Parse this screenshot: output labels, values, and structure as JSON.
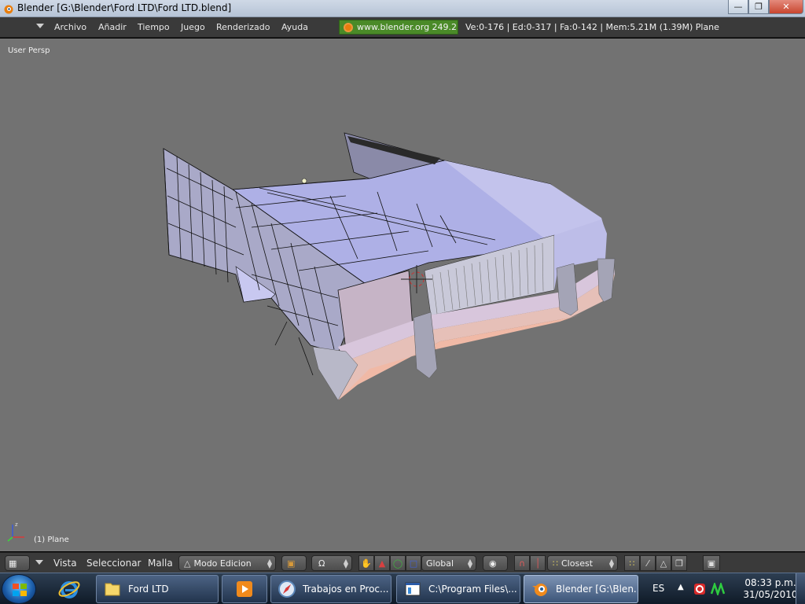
{
  "window": {
    "title": "Blender [G:\\Blender\\Ford LTD\\Ford LTD.blend]",
    "buttons": {
      "minimize": "—",
      "maximize": "❐",
      "close": "✕"
    }
  },
  "infobar": {
    "menus": [
      "Archivo",
      "Añadir",
      "Tiempo",
      "Juego",
      "Renderizado",
      "Ayuda"
    ],
    "url": "www.blender.org 249.2",
    "stats": "Ve:0-176 | Ed:0-317 | Fa:0-142 | Mem:5.21M (1.39M) Plane"
  },
  "viewport": {
    "view_label": "User Persp",
    "object_label": "(1) Plane",
    "background": "#727272",
    "mesh_face_color": "#b8b8e8",
    "mesh_edge_color": "#000000"
  },
  "bottombar": {
    "menus": [
      "Vista",
      "Seleccionar",
      "Malla"
    ],
    "mode": "Modo Edicion",
    "orientation": "Global",
    "snap": "Closest",
    "icons": [
      "viewport-type-icon",
      "shading-icon",
      "pivot-icon",
      "manipulator-hand-icon",
      "manipulator-translate-icon",
      "manipulator-rotate-icon",
      "manipulator-scale-icon",
      "proportional-icon",
      "snap-magnet-icon",
      "snap-target-icon",
      "vertex-select-icon",
      "edge-select-icon",
      "face-select-icon",
      "occlude-icon",
      "render-preview-icon"
    ]
  },
  "taskbar": {
    "tasks": [
      {
        "label": "Ford LTD",
        "icon": "folder-icon"
      },
      {
        "label": "",
        "icon": "media-player-icon"
      },
      {
        "label": "Trabajos en Proc...",
        "icon": "safari-icon"
      },
      {
        "label": "C:\\Program Files\\...",
        "icon": "window-icon"
      },
      {
        "label": "Blender [G:\\Blen...",
        "icon": "blender-icon",
        "active": true
      }
    ],
    "language": "ES",
    "time": "08:33 p.m.",
    "date": "31/05/2010"
  }
}
